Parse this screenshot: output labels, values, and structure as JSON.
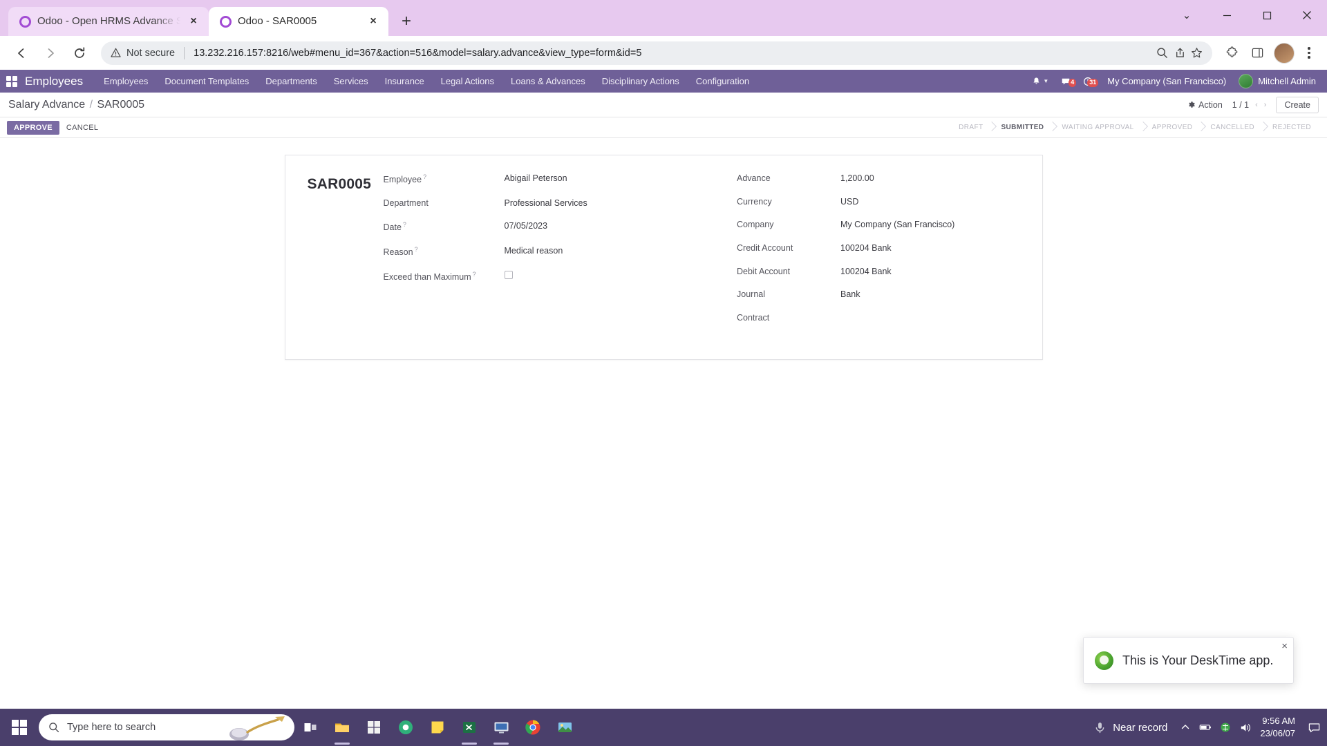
{
  "browser": {
    "tabs": [
      {
        "title": "Odoo - Open HRMS Advance Sal",
        "active": false,
        "favicon": "odoo-favicon",
        "close": "×"
      },
      {
        "title": "Odoo - SAR0005",
        "active": true,
        "favicon": "odoo-favicon",
        "close": "×"
      }
    ],
    "new_tab_label": "+",
    "window_controls": {
      "minimize": "—",
      "maximize": "❐",
      "close": "✕",
      "chevron": "⌄"
    },
    "omnibox": {
      "security_label": "Not secure",
      "url": "13.232.216.157:8216/web#menu_id=367&action=516&model=salary.advance&view_type=form&id=5"
    }
  },
  "odoo": {
    "brand": "Employees",
    "menu": [
      {
        "label": "Employees"
      },
      {
        "label": "Document Templates"
      },
      {
        "label": "Departments"
      },
      {
        "label": "Services"
      },
      {
        "label": "Insurance"
      },
      {
        "label": "Legal Actions"
      },
      {
        "label": "Loans & Advances"
      },
      {
        "label": "Disciplinary Actions"
      },
      {
        "label": "Configuration"
      }
    ],
    "systray": {
      "messages_count": "4",
      "activities_count": "31",
      "company": "My Company (San Francisco)",
      "user": "Mitchell Admin"
    },
    "control_panel": {
      "breadcrumb_root": "Salary Advance",
      "breadcrumb_sep": "/",
      "breadcrumb_current": "SAR0005",
      "action_label": "Action",
      "pager": "1 / 1",
      "pager_prev": "‹",
      "pager_next": "›",
      "create_label": "Create"
    },
    "statusbar": {
      "buttons": [
        {
          "label": "APPROVE",
          "style": "primary"
        },
        {
          "label": "CANCEL",
          "style": "link"
        }
      ],
      "stages": [
        {
          "label": "DRAFT",
          "active": false
        },
        {
          "label": "SUBMITTED",
          "active": true
        },
        {
          "label": "WAITING APPROVAL",
          "active": false
        },
        {
          "label": "APPROVED",
          "active": false
        },
        {
          "label": "CANCELLED",
          "active": false
        },
        {
          "label": "REJECTED",
          "active": false
        }
      ]
    },
    "form": {
      "record_title": "SAR0005",
      "left_fields": [
        {
          "label": "Employee",
          "help": true,
          "value": "Abigail Peterson",
          "type": "text"
        },
        {
          "label": "Department",
          "help": false,
          "value": "Professional Services",
          "type": "text"
        },
        {
          "label": "Date",
          "help": true,
          "value": "07/05/2023",
          "type": "text"
        },
        {
          "label": "Reason",
          "help": true,
          "value": "Medical reason",
          "type": "text"
        },
        {
          "label": "",
          "help": false,
          "value": "",
          "type": "spacer"
        },
        {
          "label": "Exceed than Maximum",
          "help": true,
          "value": "",
          "type": "checkbox",
          "checked": false
        }
      ],
      "right_fields": [
        {
          "label": "Advance",
          "help": false,
          "value": "1,200.00",
          "type": "text"
        },
        {
          "label": "Currency",
          "help": false,
          "value": "USD",
          "type": "text"
        },
        {
          "label": "Company",
          "help": false,
          "value": "My Company (San Francisco)",
          "type": "text"
        },
        {
          "label": "Credit Account",
          "help": false,
          "value": "100204 Bank",
          "type": "text"
        },
        {
          "label": "Debit Account",
          "help": false,
          "value": "100204 Bank",
          "type": "text"
        },
        {
          "label": "Journal",
          "help": false,
          "value": "Bank",
          "type": "text"
        },
        {
          "label": "Contract",
          "help": false,
          "value": "",
          "type": "text"
        }
      ]
    }
  },
  "toast": {
    "text": "This is Your DeskTime app.",
    "close": "×",
    "logo": "desktime-logo"
  },
  "taskbar": {
    "search_placeholder": "Type here to search",
    "tray_text": "Near record",
    "time": "9:56 AM",
    "date": "23/06/07"
  },
  "colors": {
    "odoo_purple": "#6f6098",
    "browser_tabstrip": "#e7c9ef",
    "taskbar": "#4a3f6b",
    "primary_button": "#7a6ba3",
    "badge_red": "#e04f4f"
  }
}
